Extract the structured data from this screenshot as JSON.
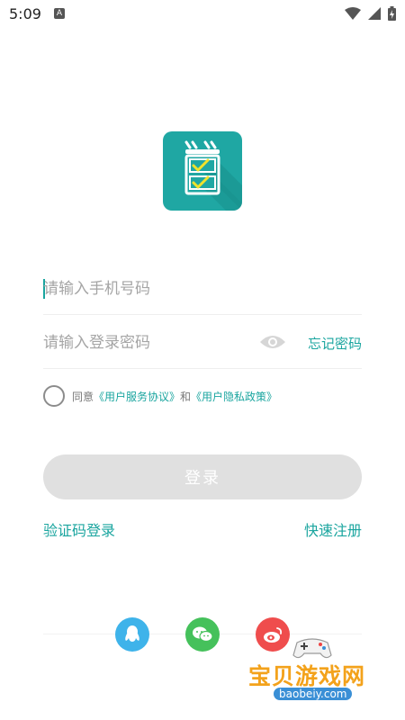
{
  "status_bar": {
    "time": "5:09",
    "notification_letter": "A",
    "icons": [
      "wifi-icon",
      "signal-icon",
      "battery-icon"
    ]
  },
  "app": {
    "logo_icon": "app-logo-icon",
    "brand_color": "#1fa7a3"
  },
  "form": {
    "phone_placeholder": "请输入手机号码",
    "password_placeholder": "请输入登录密码",
    "forgot_password": "忘记密码",
    "agreement": {
      "prefix": "同意",
      "user_service": "《用户服务协议》",
      "conjunction": "和",
      "privacy_policy": "《用户隐私政策》"
    },
    "login_button": "登录"
  },
  "links": {
    "sms_login": "验证码登录",
    "quick_register": "快速注册"
  },
  "social": [
    "qq-icon",
    "wechat-icon",
    "weibo-icon"
  ],
  "watermark": {
    "title": "宝贝游戏网",
    "domain": "baobeiy.com"
  },
  "colors": {
    "accent": "#1aa59f",
    "button_disabled": "#e0e0e0",
    "qq": "#3eb3ea",
    "wechat": "#45c15b",
    "weibo": "#ef4d4d"
  }
}
